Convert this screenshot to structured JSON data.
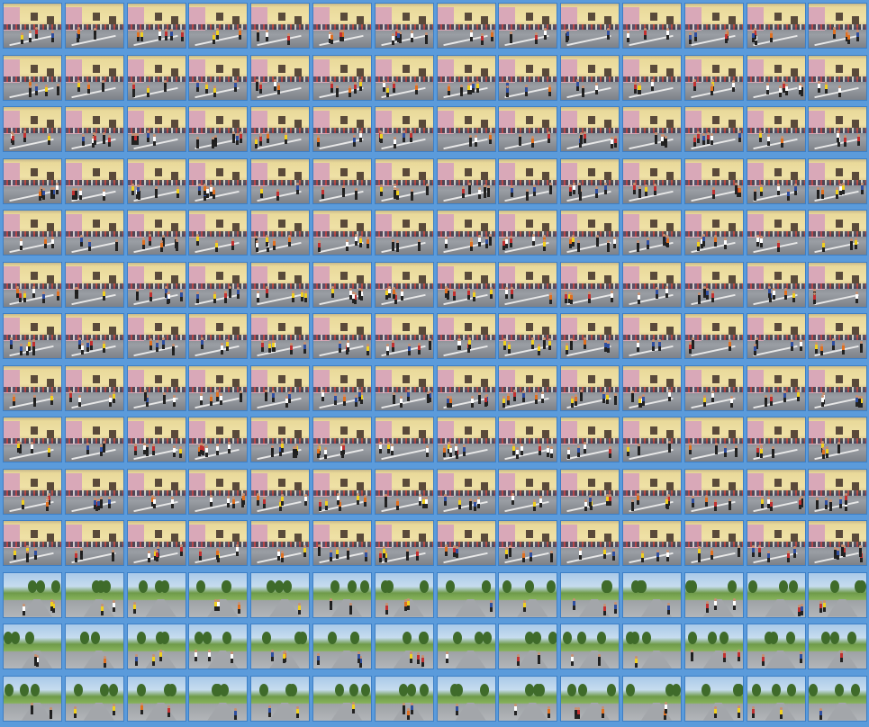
{
  "gallery": {
    "columns": 14,
    "rows": 14,
    "background_color": "#5b9bdb",
    "thumb_border_color": "#3d7fc6",
    "scene_rows": [
      "town",
      "town",
      "town",
      "town",
      "town",
      "town",
      "town",
      "town",
      "town",
      "town",
      "town",
      "country",
      "country",
      "country"
    ],
    "shirt_colors": [
      "#ffffff",
      "#c23030",
      "#2f4fa0",
      "#f0d020",
      "#1e1e1e",
      "#e07020"
    ]
  }
}
